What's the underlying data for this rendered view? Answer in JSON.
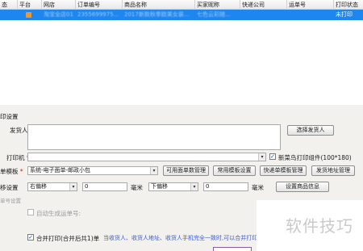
{
  "table": {
    "columns": [
      "态",
      "平台",
      "网店",
      "订单编号",
      "商品名称",
      "买家昵称",
      "快递公司",
      "运单号",
      "打印状态"
    ],
    "row": {
      "shop": "淘宝全店01",
      "order_no": "2355699975...",
      "product": "2017新款秋季欧美女装...",
      "buyer": "七色云彩随...",
      "status": "未打印"
    }
  },
  "panel": {
    "section_title": "印设置",
    "shipper_label": "发货人",
    "choose_shipper_button": "选择发货人",
    "printer_label": "打印机",
    "required_mark": "*",
    "printer_value": "",
    "cainiao_checkbox_label": "新菜鸟打印组件(100*180)",
    "cainiao_checked": "✓",
    "template_label": "单模板",
    "template_value": "系统-电子面单-邮政小包",
    "common_waybill_button": "可用面单数管理",
    "common_template_button": "常用模板设置",
    "express_template_button": "快递单模板管理",
    "ship_address_button": "发货地址管理",
    "offset_label": "移设置",
    "offset_h_value": "右偏移",
    "offset_h_input": "0",
    "unit_mm_1": "毫米",
    "offset_v_value": "下偏移",
    "offset_v_input": "0",
    "unit_mm_2": "毫米",
    "set_product_button": "设置商品信息",
    "waybill_section": "单号设置",
    "auto_waybill_label": "自动生成运单号:",
    "merge_label": "合并打印(合并后共1)单",
    "merge_checked": "✓",
    "merge_hint": "当收货人、收货人地址、收货人手机完全一致时,可以合并打印",
    "watermark": "软件技巧"
  }
}
